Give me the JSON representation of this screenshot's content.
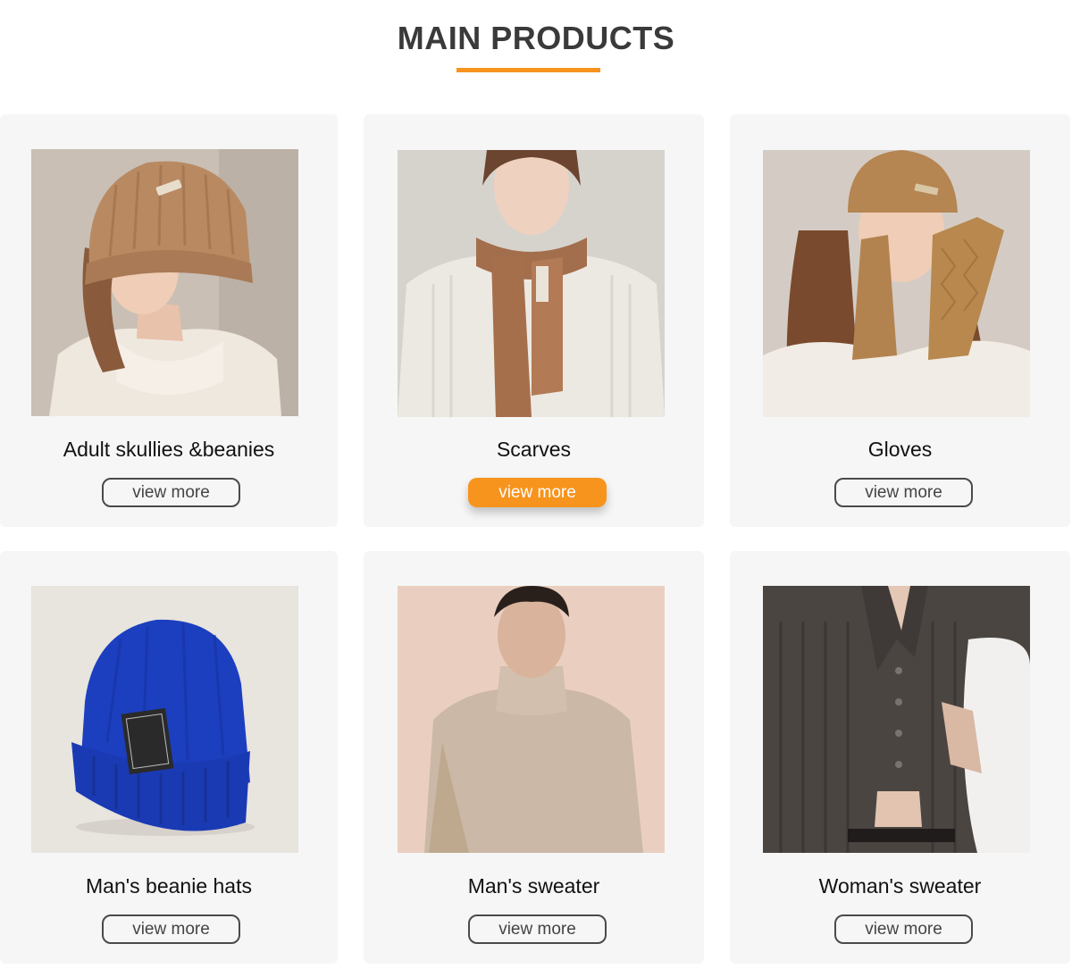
{
  "section": {
    "title": "MAIN PRODUCTS"
  },
  "colors": {
    "accent": "#f7941d",
    "card_bg": "#f6f6f6",
    "title": "#3a3a3a"
  },
  "products": [
    {
      "name": "Adult skullies &beanies",
      "button": "view more",
      "active": false,
      "image": "woman-knit-beanie-photo"
    },
    {
      "name": "Scarves",
      "button": "view more",
      "active": true,
      "image": "woman-camel-scarf-photo"
    },
    {
      "name": "Gloves",
      "button": "view more",
      "active": false,
      "image": "woman-knit-gloves-photo"
    },
    {
      "name": "Man's beanie hats",
      "button": "view more",
      "active": false,
      "image": "blue-beanie-hat-photo"
    },
    {
      "name": "Man's sweater",
      "button": "view more",
      "active": false,
      "image": "man-turtleneck-sweater-photo"
    },
    {
      "name": "Woman's sweater",
      "button": "view more",
      "active": false,
      "image": "woman-ribbed-cardigan-photo"
    }
  ]
}
